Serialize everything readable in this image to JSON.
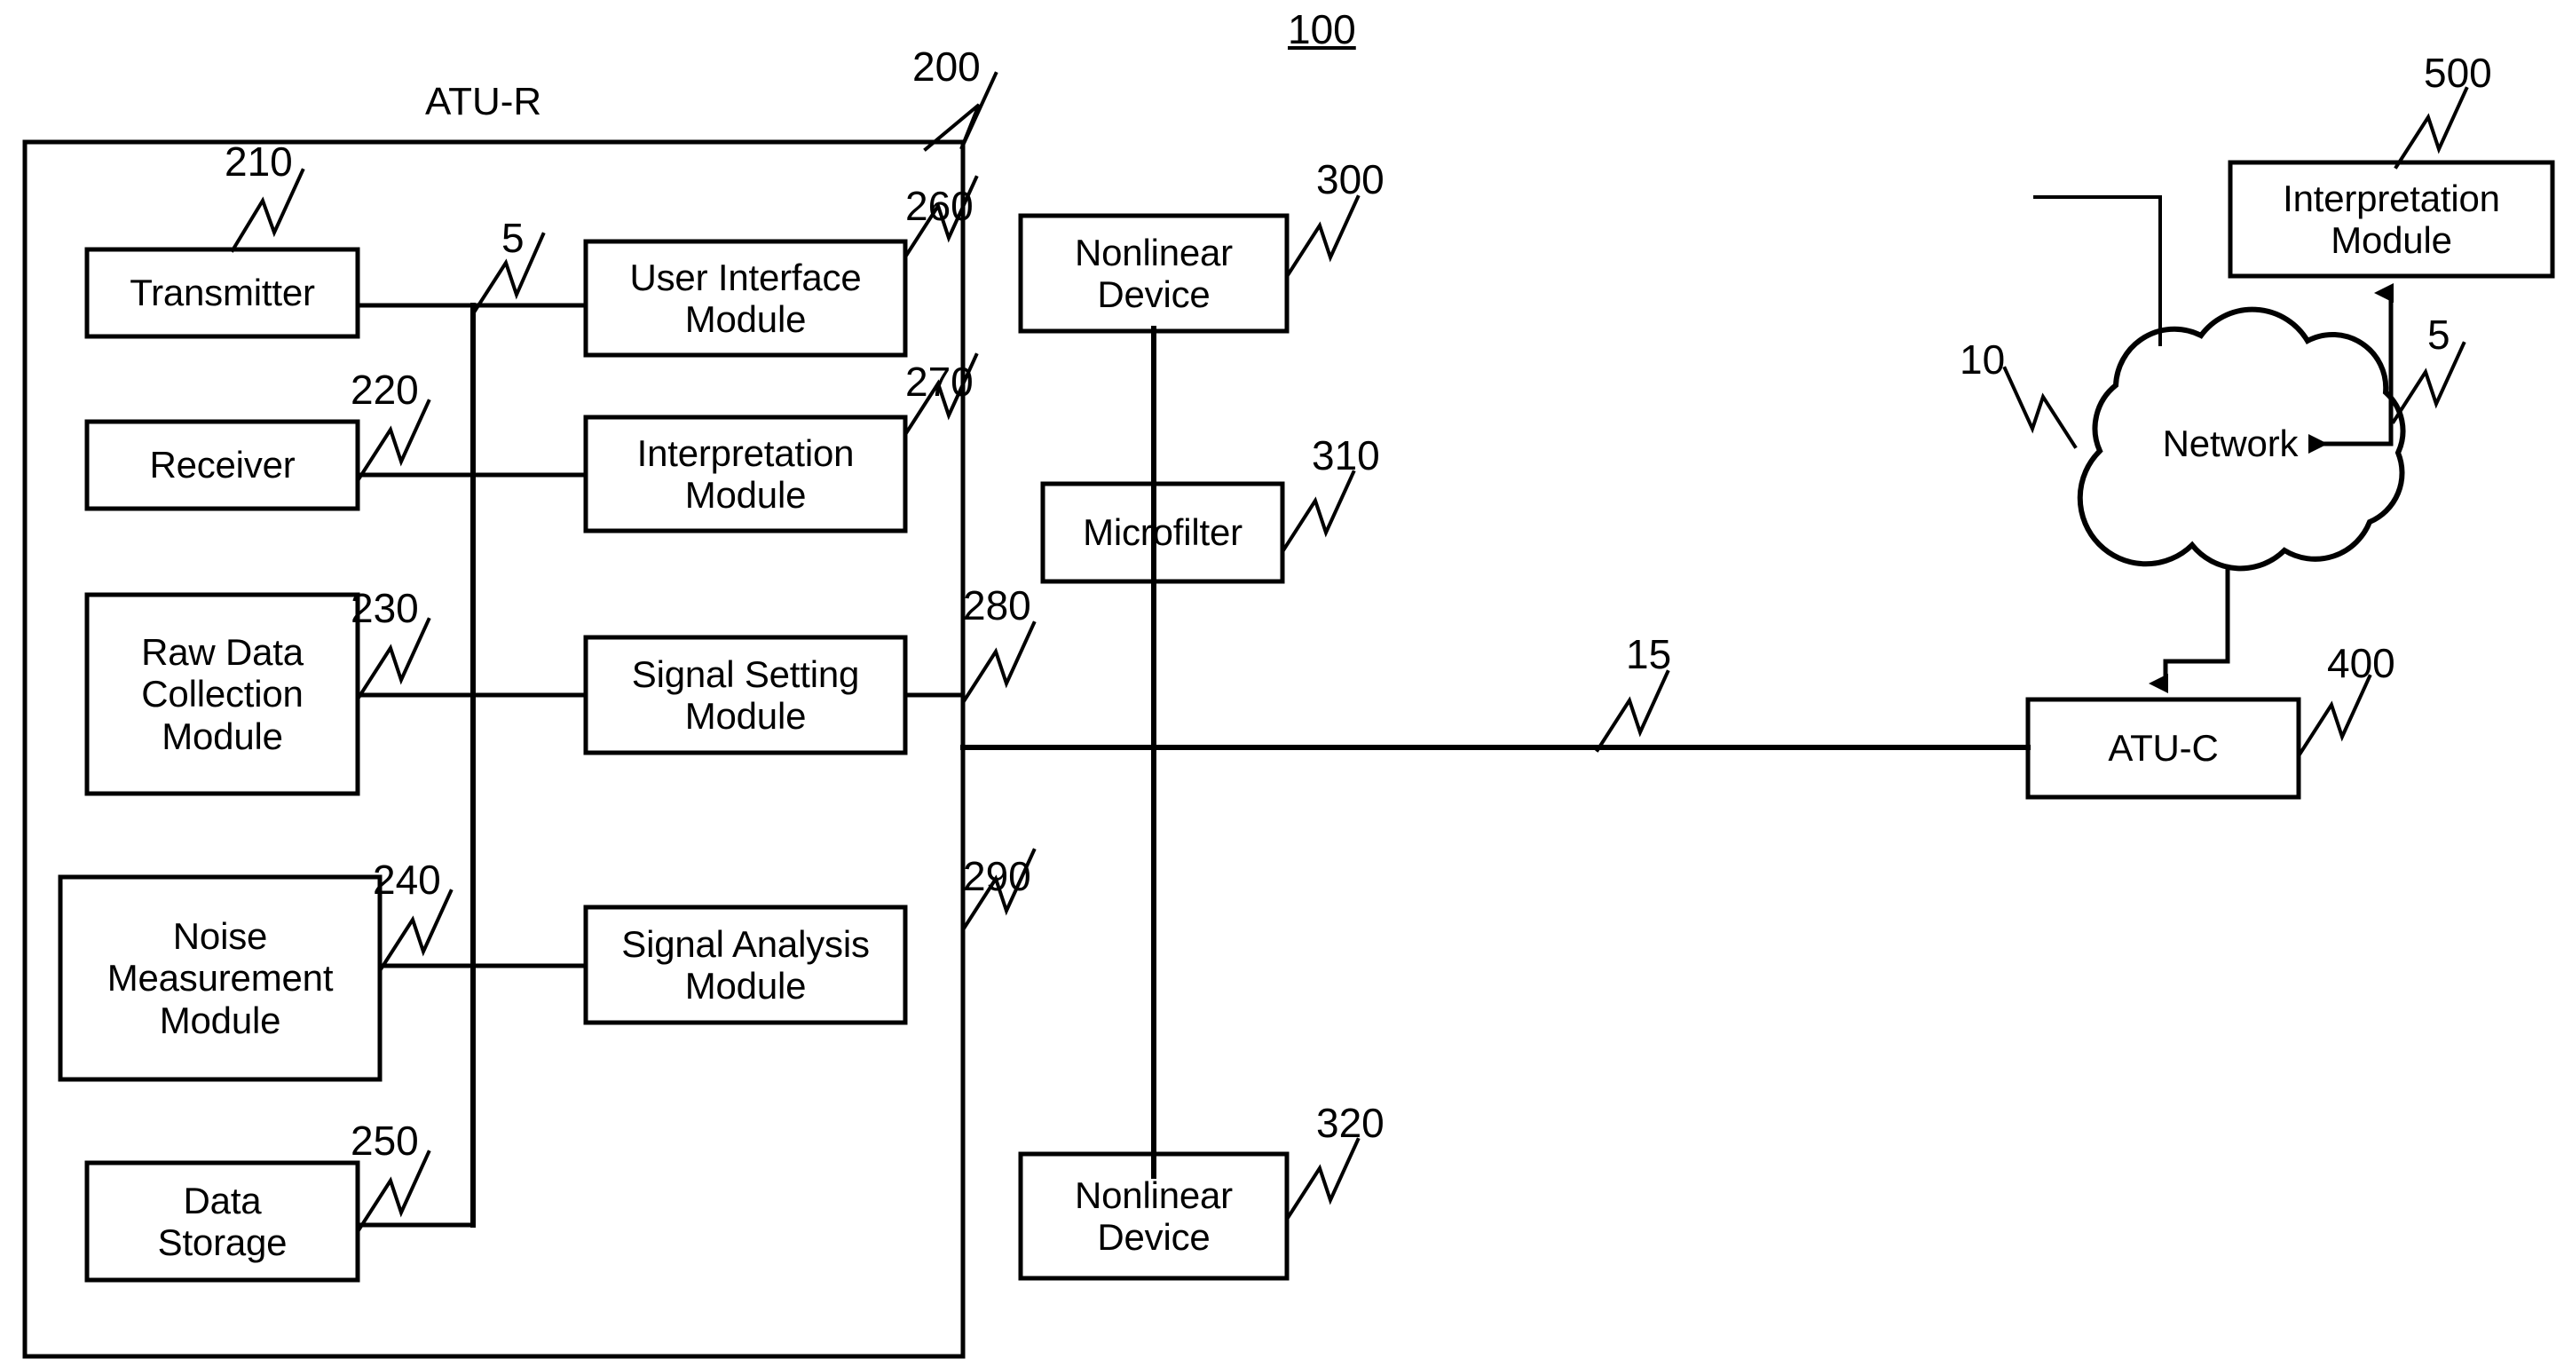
{
  "figure": {
    "number": "100",
    "system_label": "ATU-R",
    "system_label_ref": "5"
  },
  "outer_container": {
    "name": "ATU-R enclosure",
    "ref": "200"
  },
  "left_modules": [
    {
      "label": "Transmitter",
      "ref": "210"
    },
    {
      "label": "Receiver",
      "ref": "220"
    },
    {
      "label": "Raw Data\nCollection\nModule",
      "ref": "230"
    },
    {
      "label": "Noise\nMeasurement\nModule",
      "ref": "240"
    },
    {
      "label": "Data\nStorage",
      "ref": "250"
    }
  ],
  "right_modules": [
    {
      "label": "User Interface\nModule",
      "ref": "260"
    },
    {
      "label": "Interpretation\nModule",
      "ref": "270"
    },
    {
      "label": "Signal Setting\nModule",
      "ref": "280"
    },
    {
      "label": "Signal Analysis\nModule",
      "ref": "290"
    }
  ],
  "center_column": [
    {
      "label": "Nonlinear\nDevice",
      "ref": "300"
    },
    {
      "label": "Microfilter",
      "ref": "310"
    },
    {
      "label": "Nonlinear\nDevice",
      "ref": "320"
    }
  ],
  "loop": {
    "label": "",
    "ref": "15"
  },
  "right_side": {
    "atu_c": {
      "label": "ATU-C",
      "ref": "400"
    },
    "network": {
      "label": "Network",
      "ref": "10"
    },
    "interpretation": {
      "label": "Interpretation\nModule",
      "ref": "500"
    },
    "network_link_ref": "5"
  }
}
